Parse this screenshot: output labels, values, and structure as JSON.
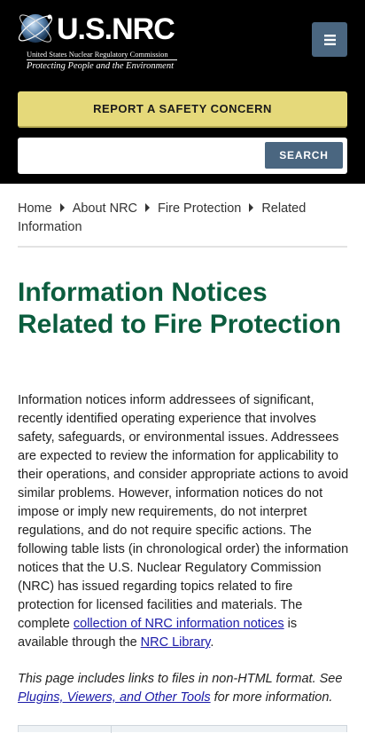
{
  "header": {
    "logo_word": "U.S.NRC",
    "logo_sub": "United States Nuclear Regulatory Commission",
    "logo_tagline": "Protecting People and the Environment",
    "menu_icon": "hamburger-icon",
    "report_label": "REPORT A SAFETY CONCERN",
    "search_placeholder": "",
    "search_label": "SEARCH"
  },
  "breadcrumb": [
    "Home",
    "About NRC",
    "Fire Protection",
    "Related Information"
  ],
  "page_title": "Information Notices Related to Fire Protection",
  "body": {
    "text_1": "Information notices inform addressees of significant, recently identified operating experience that involves safety, safeguards, or environmental issues. Addressees are expected to review the information for applicability to their operations, and consider appropriate actions to avoid similar problems. However, information notices do not impose or imply new requirements, do not interpret regulations, and do not require specific actions. The following table lists (in chronological order) the information notices that the U.S. Nuclear Regulatory Commission (NRC) has issued regarding topics related to fire protection for licensed facilities and materials. The complete ",
    "link_1": "collection of NRC information notices",
    "text_2": " is available through the ",
    "link_2": "NRC Library",
    "text_3": "."
  },
  "note": {
    "text_1": "This page includes links to files in non-HTML format. See ",
    "link": "Plugins, Viewers, and Other Tools",
    "text_2": " for more information."
  },
  "colors": {
    "header_bg": "#000000",
    "report_button": "#e5d97a",
    "accent_slate": "#4a6680",
    "title_green": "#0b5d3e",
    "link_blue": "#1a1aa8"
  }
}
